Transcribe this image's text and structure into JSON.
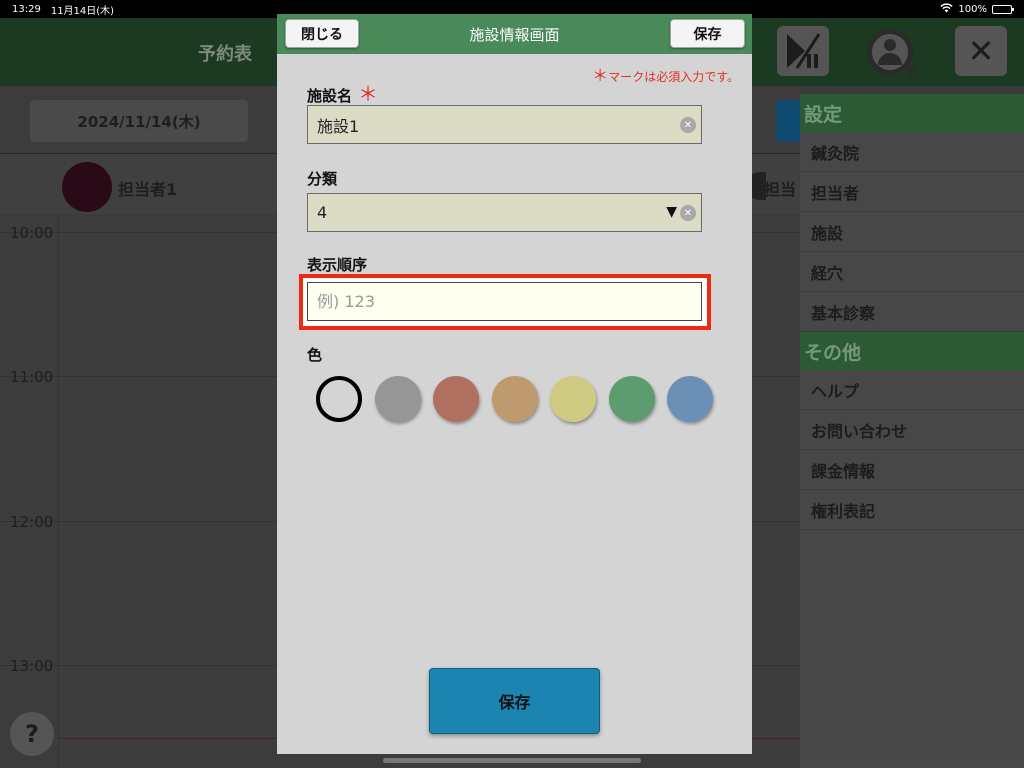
{
  "status_bar": {
    "time": "13:29",
    "date": "11月14日(木)",
    "battery": "100%"
  },
  "background": {
    "header_title": "予約表",
    "date_button": "2024/11/14(木)",
    "staff_1": "担当者1",
    "staff_2": "担当",
    "time_labels": [
      "10:00",
      "11:00",
      "12:00",
      "13:00"
    ],
    "play_pause_icon": "▶‖",
    "close_icon": "✕",
    "help_label": "?"
  },
  "settings_panel": {
    "section_settings": "設定",
    "settings_items": [
      "鍼灸院",
      "担当者",
      "施設",
      "経穴",
      "基本診察"
    ],
    "section_other": "その他",
    "other_items": [
      "ヘルプ",
      "お問い合わせ",
      "課金情報",
      "権利表記"
    ]
  },
  "modal": {
    "title": "施設情報画面",
    "close_button": "閉じる",
    "save_button": "保存",
    "required_note_mark": "＊",
    "required_note": "マークは必須入力です。",
    "facility_name_label": "施設名",
    "required_mark": "＊",
    "facility_name_value": "施設1",
    "category_label": "分類",
    "category_value": "4",
    "dropdown_arrow": "▼",
    "clear_icon": "✕",
    "display_order_label": "表示順序",
    "display_order_placeholder": "例) 123",
    "display_order_value": "",
    "color_label": "色",
    "colors": [
      "none",
      "#969696",
      "#b07060",
      "#bf9a6e",
      "#cfca82",
      "#5d9c70",
      "#6b90b6"
    ],
    "bottom_save_button": "保存"
  }
}
